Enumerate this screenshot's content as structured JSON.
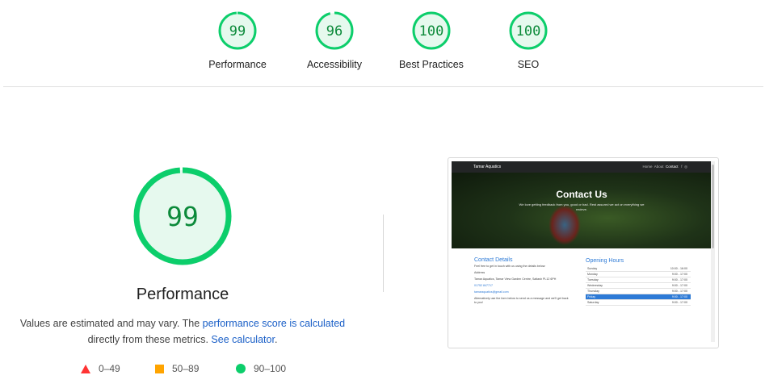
{
  "categories": [
    {
      "label": "Performance",
      "score": "99",
      "fraction": 0.99
    },
    {
      "label": "Accessibility",
      "score": "96",
      "fraction": 0.96
    },
    {
      "label": "Best Practices",
      "score": "100",
      "fraction": 1.0
    },
    {
      "label": "SEO",
      "score": "100",
      "fraction": 1.0
    }
  ],
  "main": {
    "score": "99",
    "fraction": 0.99,
    "title": "Performance",
    "note_prefix": "Values are estimated and may vary. The ",
    "note_link1": "performance score is calculated",
    "note_middle": " directly from these metrics. ",
    "note_link2": "See calculator",
    "note_suffix": "."
  },
  "legend": [
    {
      "icon": "red-triangle-icon",
      "label": "0–49",
      "color": "#ff3333"
    },
    {
      "icon": "orange-square-icon",
      "label": "50–89",
      "color": "#ffa400"
    },
    {
      "icon": "green-circle-icon",
      "label": "90–100",
      "color": "#0cce6b"
    }
  ],
  "colors": {
    "pass_stroke": "#0cce6b",
    "pass_fill": "#e6f9ee",
    "pass_text": "#0c8a3a",
    "link": "#1a5fc7"
  },
  "screenshot": {
    "brand": "Tamar Aquatics",
    "nav": [
      "Home",
      "About",
      "Contact",
      "f",
      "◎"
    ],
    "hero_title": "Contact Us",
    "hero_text": "We love getting feedback from you, good or bad. Rest assured we act on everything we recieve.",
    "details_title": "Contact Details",
    "details_lines": [
      "Feel free to get in touch with us using the details below:",
      "Address",
      "Tamar Aquatics, Tamar View Garden Centre, Saltash PL12 6PH",
      "01752 847717",
      "tamaraquatics@gmail.com",
      "Alternatively use the form below to send us a message and we'll get back to you!"
    ],
    "hours_title": "Opening Hours",
    "hours": [
      {
        "day": "Sunday",
        "time": "10:00 - 16:00"
      },
      {
        "day": "Monday",
        "time": "9:00 - 17:00"
      },
      {
        "day": "Tuesday",
        "time": "9:00 - 17:00"
      },
      {
        "day": "Wednesday",
        "time": "9:00 - 17:00"
      },
      {
        "day": "Thursday",
        "time": "9:00 - 17:00"
      },
      {
        "day": "Friday",
        "time": "9:00 - 17:00"
      },
      {
        "day": "Saturday",
        "time": "9:00 - 17:00"
      }
    ]
  }
}
